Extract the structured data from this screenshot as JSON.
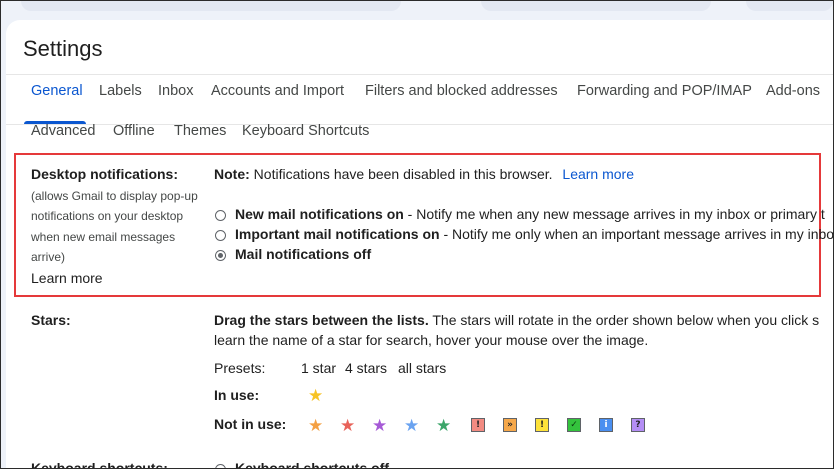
{
  "page": {
    "title": "Settings"
  },
  "tabs": {
    "row1": [
      "General",
      "Labels",
      "Inbox",
      "Accounts and Import",
      "Filters and blocked addresses",
      "Forwarding and POP/IMAP",
      "Add-ons"
    ],
    "row2": [
      "Advanced",
      "Offline",
      "Themes",
      "Keyboard Shortcuts"
    ],
    "active": "General"
  },
  "desktop_notifications": {
    "label": "Desktop notifications:",
    "description": [
      "(allows Gmail to display pop-up",
      "notifications on your desktop",
      "when new email messages",
      "arrive)"
    ],
    "learn_more": "Learn more",
    "note_label": "Note:",
    "note_text": "Notifications have been disabled in this browser.",
    "note_link": "Learn more",
    "options": [
      {
        "label": "New mail notifications on",
        "desc": " - Notify me when any new message arrives in my inbox or primary t",
        "checked": false
      },
      {
        "label": "Important mail notifications on",
        "desc": " - Notify me only when an important message arrives in my inbox",
        "checked": false
      },
      {
        "label": "Mail notifications off",
        "desc": "",
        "checked": true
      }
    ]
  },
  "stars": {
    "label": "Stars:",
    "intro_bold": "Drag the stars between the lists.",
    "intro_text": " The stars will rotate in the order shown below when you click s",
    "intro_line2": "learn the name of a star for search, hover your mouse over the image.",
    "presets_label": "Presets:",
    "presets": [
      "1 star",
      "4 stars",
      "all stars"
    ],
    "in_use_label": "In use:",
    "not_in_use_label": "Not in use:",
    "in_use": [
      {
        "icon": "yellow-star-icon",
        "color": "#f7c325"
      }
    ],
    "not_in_use": [
      {
        "icon": "orange-star-icon",
        "kind": "star",
        "color": "#f4a043"
      },
      {
        "icon": "red-star-icon",
        "kind": "star",
        "color": "#e8635a"
      },
      {
        "icon": "purple-star-icon",
        "kind": "star",
        "color": "#a65ad6"
      },
      {
        "icon": "blue-star-icon",
        "kind": "star",
        "color": "#6aa3f0"
      },
      {
        "icon": "green-star-icon",
        "kind": "star",
        "color": "#3ca66a"
      },
      {
        "icon": "red-bang-icon",
        "kind": "box",
        "glyph": "!",
        "color": "#f28b82",
        "fg": "#202124"
      },
      {
        "icon": "orange-guillemet-icon",
        "kind": "box",
        "glyph": "»",
        "color": "#f6a84a",
        "fg": "#202124"
      },
      {
        "icon": "yellow-bang-icon",
        "kind": "box",
        "glyph": "!",
        "color": "#fde23a",
        "fg": "#202124"
      },
      {
        "icon": "green-check-icon",
        "kind": "box",
        "glyph": "✓",
        "color": "#34c33d",
        "fg": "#0b3d0f"
      },
      {
        "icon": "blue-info-icon",
        "kind": "box",
        "glyph": "i",
        "color": "#4a8ff0",
        "fg": "#ffffff"
      },
      {
        "icon": "purple-question-icon",
        "kind": "box",
        "glyph": "?",
        "color": "#b48ef5",
        "fg": "#202124"
      }
    ]
  },
  "keyboard_shortcuts": {
    "label": "Keyboard shortcuts:",
    "option": "Keyboard shortcuts off"
  }
}
